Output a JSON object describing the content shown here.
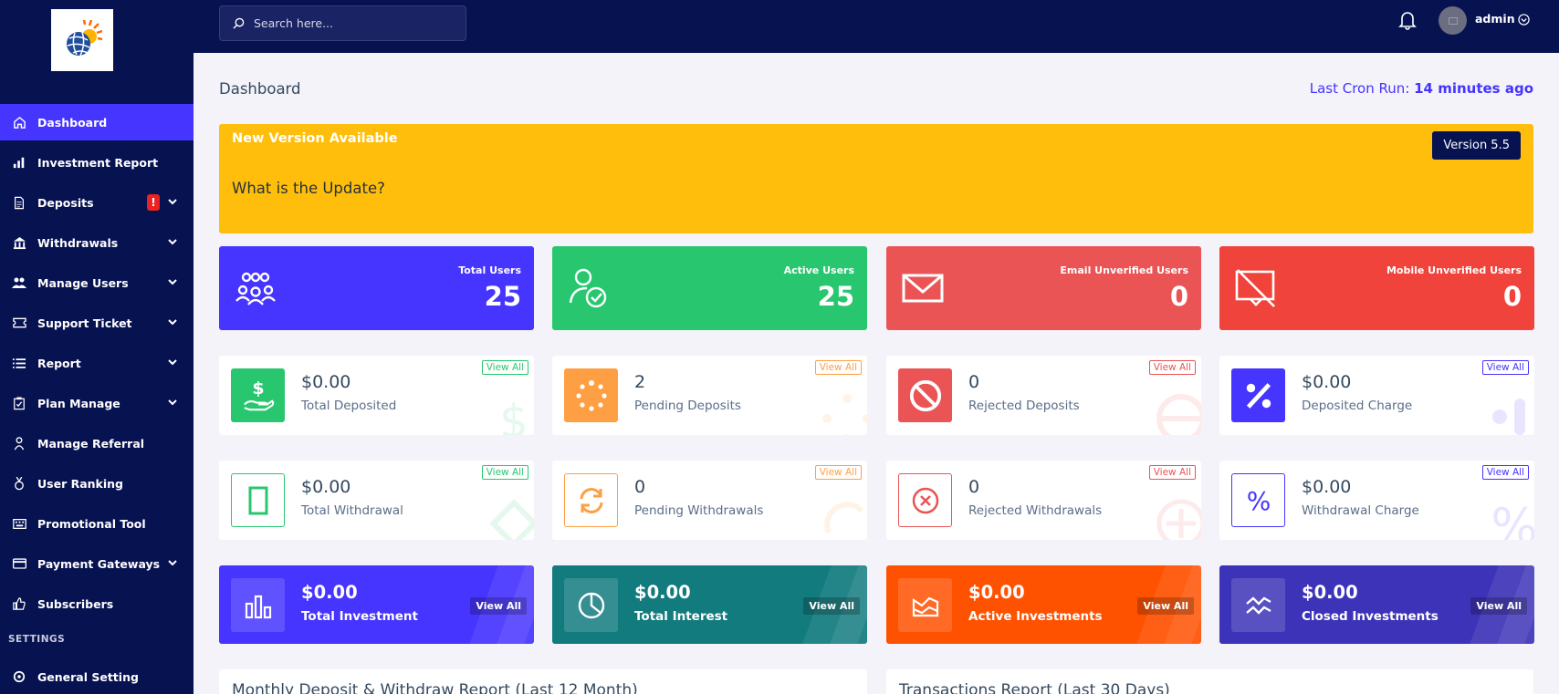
{
  "search": {
    "placeholder": "Search here..."
  },
  "user": {
    "name": "admin"
  },
  "sidebar": {
    "items": [
      {
        "label": "Dashboard",
        "icon": "home-icon",
        "active": true
      },
      {
        "label": "Investment Report",
        "icon": "bar-chart-icon"
      },
      {
        "label": "Deposits",
        "icon": "file-invoice-icon",
        "badge": "!",
        "dropdown": true
      },
      {
        "label": "Withdrawals",
        "icon": "bank-icon",
        "dropdown": true
      },
      {
        "label": "Manage Users",
        "icon": "users-icon",
        "dropdown": true
      },
      {
        "label": "Support Ticket",
        "icon": "ticket-icon",
        "dropdown": true
      },
      {
        "label": "Report",
        "icon": "list-icon",
        "dropdown": true
      },
      {
        "label": "Plan Manage",
        "icon": "clipboard-check-icon",
        "dropdown": true
      },
      {
        "label": "Manage Referral",
        "icon": "person-icon"
      },
      {
        "label": "User Ranking",
        "icon": "medal-icon"
      },
      {
        "label": "Promotional Tool",
        "icon": "keyboard-icon"
      },
      {
        "label": "Payment Gateways",
        "icon": "credit-card-icon",
        "dropdown": true
      },
      {
        "label": "Subscribers",
        "icon": "thumbs-up-icon"
      }
    ],
    "settings_title": "SETTINGS",
    "settings_items": [
      {
        "label": "General Setting",
        "icon": "gear-icon"
      }
    ]
  },
  "page": {
    "title": "Dashboard",
    "cron_label": "Last Cron Run:",
    "cron_value": "14 minutes ago"
  },
  "notice": {
    "title": "New Version Available",
    "subtitle": "What is the Update?",
    "version": "Version 5.5"
  },
  "big_stats": [
    {
      "label": "Total Users",
      "value": "25",
      "color": "#4634ff",
      "icon": "users-group-icon"
    },
    {
      "label": "Active Users",
      "value": "25",
      "color": "#28c76f",
      "icon": "user-check-icon"
    },
    {
      "label": "Email Unverified Users",
      "value": "0",
      "color": "#ea5455",
      "icon": "envelope-icon"
    },
    {
      "label": "Mobile Unverified Users",
      "value": "0",
      "color": "#f0433b",
      "icon": "mobile-slash-icon"
    }
  ],
  "deposit_stats": [
    {
      "value": "$0.00",
      "label": "Total Deposited",
      "view": "View All",
      "color": "#28c76f",
      "icon": "hand-dollar-icon"
    },
    {
      "value": "2",
      "label": "Pending Deposits",
      "view": "View All",
      "color": "#ff9f43",
      "icon": "spinner-icon"
    },
    {
      "value": "0",
      "label": "Rejected Deposits",
      "view": "View All",
      "color": "#ea5455",
      "icon": "ban-icon"
    },
    {
      "value": "$0.00",
      "label": "Deposited Charge",
      "view": "View All",
      "color": "#4634ff",
      "icon": "percent-icon"
    }
  ],
  "withdraw_stats": [
    {
      "value": "$0.00",
      "label": "Total Withdrawal",
      "view": "View All",
      "color": "#28c76f",
      "icon": "rectangle-icon"
    },
    {
      "value": "0",
      "label": "Pending Withdrawals",
      "view": "View All",
      "color": "#ff9f43",
      "icon": "sync-icon"
    },
    {
      "value": "0",
      "label": "Rejected Withdrawals",
      "view": "View All",
      "color": "#ea5455",
      "icon": "times-circle-icon"
    },
    {
      "value": "$0.00",
      "label": "Withdrawal Charge",
      "view": "View All",
      "color": "#4634ff",
      "icon": "percent-icon"
    }
  ],
  "invest_stats": [
    {
      "value": "$0.00",
      "label": "Total Investment",
      "view": "View All",
      "color": "#4634ff",
      "icon": "chart-bar-icon"
    },
    {
      "value": "$0.00",
      "label": "Total Interest",
      "view": "View All",
      "color": "#127b7e",
      "icon": "pie-chart-icon"
    },
    {
      "value": "$0.00",
      "label": "Active Investments",
      "view": "View All",
      "color": "#ff5200",
      "icon": "chart-area-icon"
    },
    {
      "value": "$0.00",
      "label": "Closed Investments",
      "view": "View All",
      "color": "#3d33b8",
      "icon": "chart-line-icon"
    }
  ],
  "bottom_cards": [
    {
      "title": "Monthly Deposit & Withdraw Report (Last 12 Month)"
    },
    {
      "title": "Transactions Report (Last 30 Days)"
    }
  ]
}
